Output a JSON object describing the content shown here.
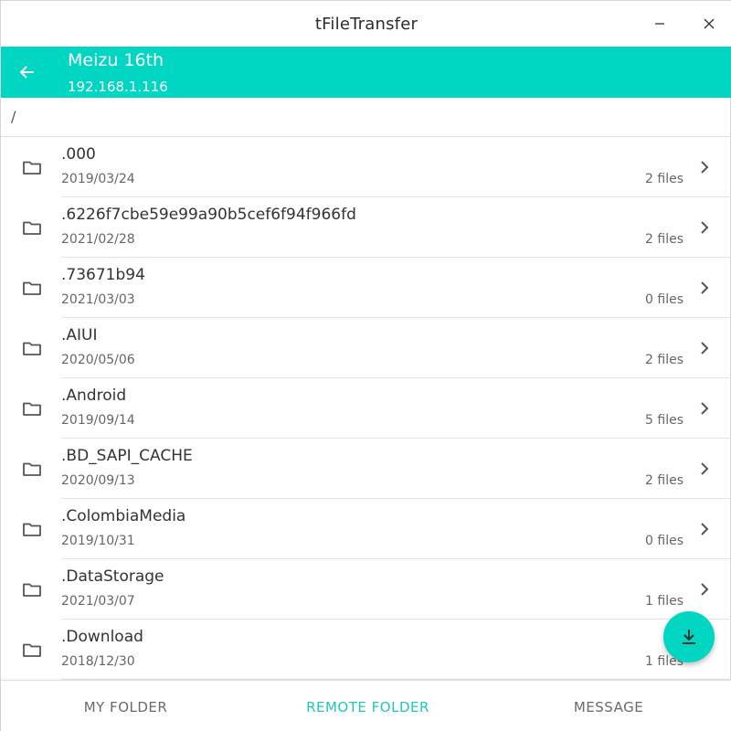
{
  "window": {
    "title": "tFileTransfer",
    "minimize_icon": "minimize-icon",
    "close_icon": "close-icon"
  },
  "header": {
    "device_name": "Meizu 16th",
    "device_ip": "192.168.1.116",
    "back_icon": "arrow-left-icon"
  },
  "path": "/",
  "files": [
    {
      "name": ".000",
      "date": "2019/03/24",
      "count": "2 files"
    },
    {
      "name": ".6226f7cbe59e99a90b5cef6f94f966fd",
      "date": "2021/02/28",
      "count": "2 files"
    },
    {
      "name": ".73671b94",
      "date": "2021/03/03",
      "count": "0 files"
    },
    {
      "name": ".AIUI",
      "date": "2020/05/06",
      "count": "2 files"
    },
    {
      "name": ".Android",
      "date": "2019/09/14",
      "count": "5 files"
    },
    {
      "name": ".BD_SAPI_CACHE",
      "date": "2020/09/13",
      "count": "2 files"
    },
    {
      "name": ".ColombiaMedia",
      "date": "2019/10/31",
      "count": "0 files"
    },
    {
      "name": ".DataStorage",
      "date": "2021/03/07",
      "count": "1 files"
    },
    {
      "name": ".Download",
      "date": "2018/12/30",
      "count": "1 files"
    }
  ],
  "fab_icon": "download-icon",
  "nav": {
    "tabs": [
      {
        "label": "MY FOLDER",
        "active": false
      },
      {
        "label": "REMOTE FOLDER",
        "active": true
      },
      {
        "label": "MESSAGE",
        "active": false
      }
    ]
  },
  "colors": {
    "accent": "#00d6c1",
    "accent_text": "#1fc7bb"
  }
}
